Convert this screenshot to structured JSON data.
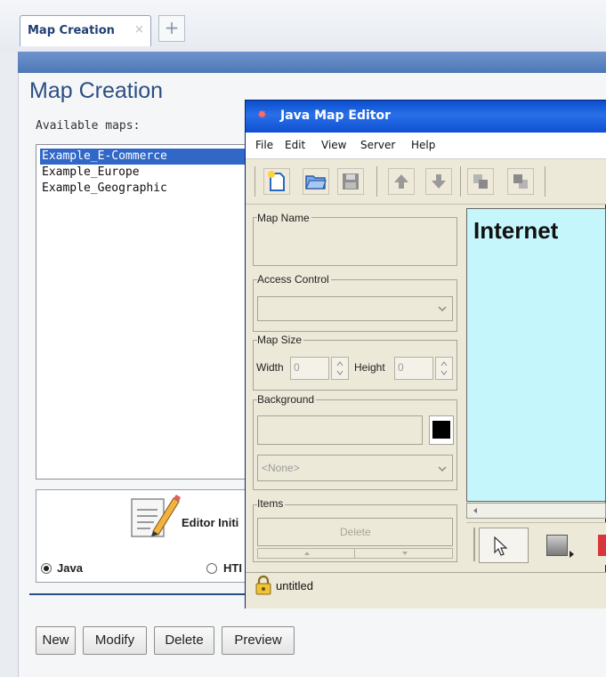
{
  "tabs": {
    "active_label": "Map Creation",
    "close_glyph": "×",
    "add_glyph": "+"
  },
  "main": {
    "title": "Map Creation",
    "available_label": "Available maps:",
    "maps": [
      "Example_E-Commerce",
      "Example_Europe",
      "Example_Geographic"
    ],
    "selected_index": 0,
    "editor_label": "Editor Initi",
    "radio_java": "Java",
    "radio_html": "HTI",
    "buttons": {
      "new": "New",
      "modify": "Modify",
      "delete": "Delete",
      "preview": "Preview"
    }
  },
  "java_window": {
    "title": "Java Map Editor",
    "menus": [
      "File",
      "Edit",
      "View",
      "Server",
      "Help"
    ],
    "map_name_label": "Map Name",
    "access_control_label": "Access Control",
    "map_size_label": "Map Size",
    "width_label": "Width",
    "width_value": "0",
    "height_label": "Height",
    "height_value": "0",
    "background_label": "Background",
    "background_select": "<None>",
    "items_label": "Items",
    "delete_button": "Delete",
    "canvas_text": "Internet",
    "status_text": "untitled"
  },
  "colors": {
    "accent_blue": "#2c4e83",
    "selection": "#3167c6",
    "canvas": "#c5f6fb",
    "titlebar": "#1a5bdc"
  }
}
